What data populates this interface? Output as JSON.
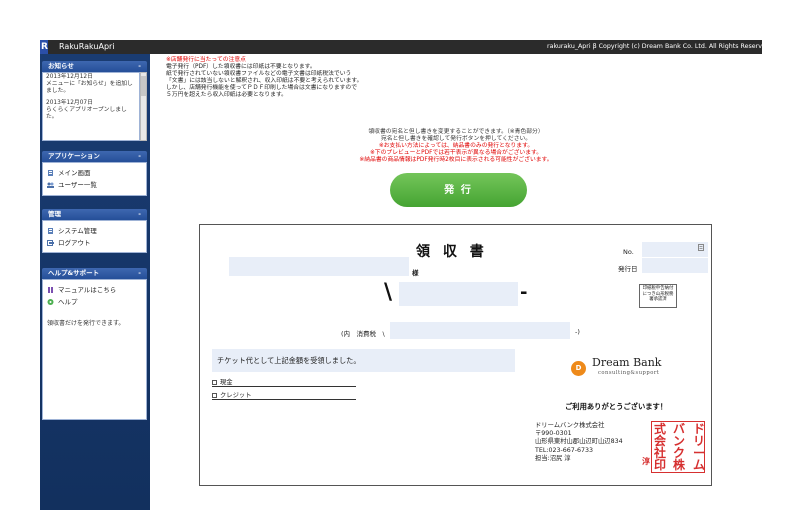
{
  "app": {
    "title": "RakuRakuApri",
    "copyright": "rakuraku_Apri β Copyright (c) Dream Bank Co. Ltd. All Rights Reserv"
  },
  "sidebar": {
    "news": {
      "title": "お知らせ",
      "toggle": "-",
      "items": [
        {
          "date": "2013年12月12日",
          "text": "メニューに「お知らせ」を追加しました。"
        },
        {
          "date": "2013年12月07日",
          "text": "らくらくアプリオープンしました。"
        }
      ]
    },
    "applications": {
      "title": "アプリケーション",
      "toggle": "-",
      "items": [
        {
          "label": "メイン画面",
          "icon": "document-icon"
        },
        {
          "label": "ユーザー一覧",
          "icon": "users-icon"
        }
      ]
    },
    "admin": {
      "title": "管理",
      "toggle": "-",
      "items": [
        {
          "label": "システム管理",
          "icon": "document-icon"
        },
        {
          "label": "ログアウト",
          "icon": "logout-icon"
        }
      ]
    },
    "help": {
      "title": "ヘルプ&サポート",
      "toggle": "-",
      "items": [
        {
          "label": "マニュアルはこちら",
          "icon": "bookmark-icon"
        },
        {
          "label": "ヘルプ",
          "icon": "help-icon"
        }
      ],
      "note": "領収書だけを発行できます。"
    }
  },
  "notice": {
    "heading": "※店舗発行に当たっての注意点",
    "lines": [
      "電子発行（PDF）した領収書には印紙は不要となります。",
      "紙で発行されていない領収書ファイルなどの電子文書は印紙税法でいう",
      "「文書」には該当しないと解釈され、収入印紙は不要と考えられています。",
      "しかし、店舗発行機能を使ってＰＤＦ印刷した場合は文書になりますので",
      "５万円を超えたら収入印紙は必要となります。"
    ]
  },
  "info": {
    "lines": [
      "領収書の宛名と但し書きを変更することができます。（※青色部分）",
      "宛名と但し書きを確認して発行ボタンを押してください。"
    ],
    "red_lines": [
      "※お支払い方法によっては、納品書のみの発行となります。",
      "※下のプレビューとPDFでは若干表示が異なる場合がございます。",
      "※納品書の商品情報はPDF発行時2枚目に表示される可能性がございます。"
    ]
  },
  "issue_button": {
    "label": "発 行"
  },
  "receipt": {
    "title": "領 収 書",
    "no_label": "No.",
    "issue_date_label": "発行日",
    "recipient_suffix": "様",
    "yen_symbol": "\\",
    "amount_dash": "-",
    "tax_label": "(内　消費税　\\",
    "tax_suffix": "-)",
    "stamp_note": "印紙税申告納付につき山形税務署承認済",
    "description": "チケット代として上記金額を受領しました。",
    "payment_options": [
      "現金",
      "クレジット"
    ],
    "logo_name": "Dream Bank",
    "logo_subtitle": "consulting&support",
    "logo_mark": "D",
    "thanks": "ご利用ありがとうございます！",
    "company_lines": [
      "ドリームバンク株式会社",
      "〒990-0301",
      "山形県東村山郡山辺町山辺834",
      "TEL:023-667-6733",
      "担当:沼尻 淳"
    ],
    "small_seal": "淳",
    "seal_chars": [
      "ド",
      "リ",
      "ー",
      "ム",
      "バ",
      "ン",
      "ク",
      "株",
      "式",
      "会",
      "社",
      "印"
    ]
  },
  "colors": {
    "topbar": "#2b2b2b",
    "sidebar": "#1a3c72",
    "panel_header": "#2f5aa3",
    "issue_button": "#5db845",
    "notice_red": "#e00000",
    "field_blue": "#e8eef8",
    "seal_red": "#d63030"
  }
}
